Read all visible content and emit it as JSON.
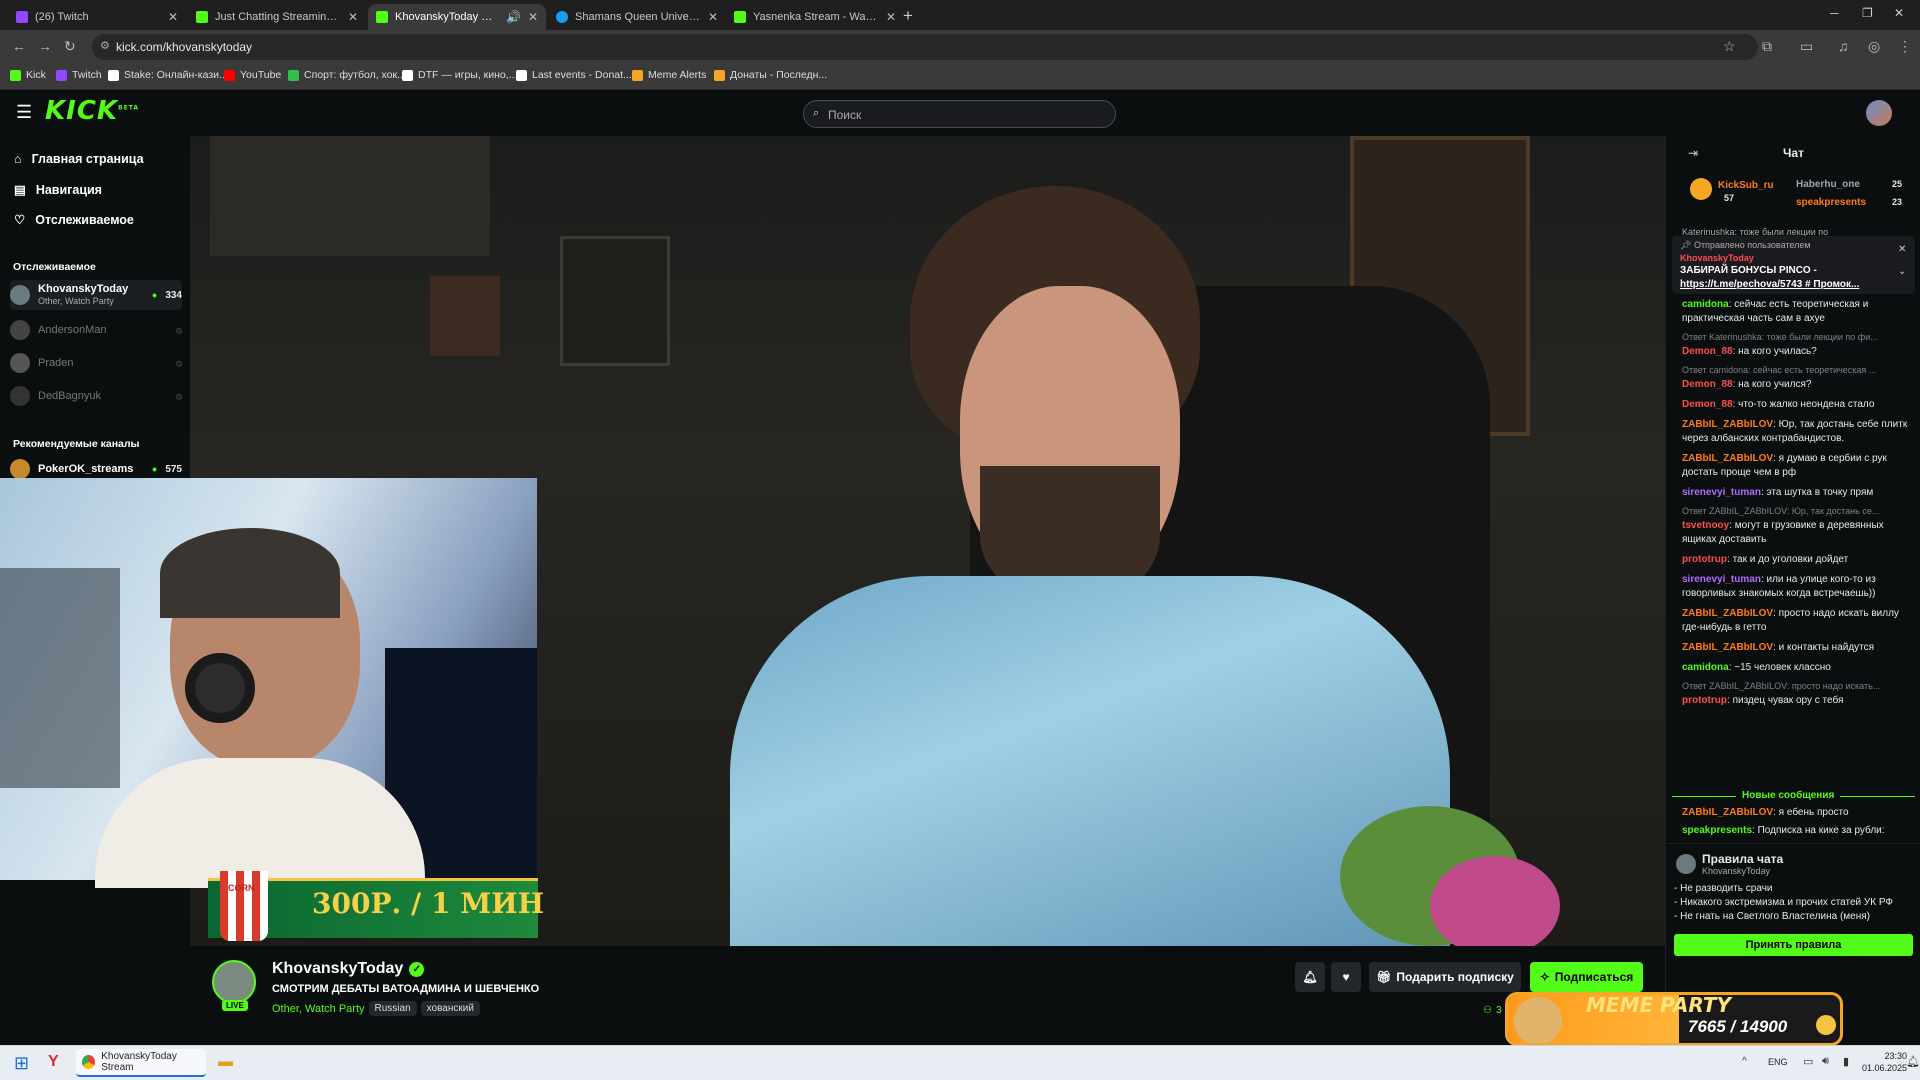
{
  "browser": {
    "tabs": [
      {
        "title": "(26) Twitch",
        "favicon_color": "#9146ff"
      },
      {
        "title": "Just Chatting Streaming - Live S",
        "favicon_color": "#53fc18"
      },
      {
        "title": "KhovanskyToday Stream - Vi",
        "favicon_color": "#53fc18",
        "active": true
      },
      {
        "title": "Shamans Queen Universe. Leve",
        "favicon_color": "#1d9bf0"
      },
      {
        "title": "Yasnenka Stream - Watch Live o",
        "favicon_color": "#53fc18"
      }
    ],
    "new_tab_label": "+",
    "url": "kick.com/khovanskytoday",
    "bookmarks": [
      {
        "label": "Kick",
        "color": "#53fc18"
      },
      {
        "label": "Twitch",
        "color": "#9146ff"
      },
      {
        "label": "Stake: Онлайн-кази...",
        "color": "#ffffff"
      },
      {
        "label": "YouTube",
        "color": "#ff0000"
      },
      {
        "label": "Спорт: футбол, хок...",
        "color": "#2fbf4f"
      },
      {
        "label": "DTF — игры, кино,...",
        "color": "#ffffff"
      },
      {
        "label": "Last events - Donat...",
        "color": "#ffffff"
      },
      {
        "label": "Meme Alerts",
        "color": "#f5a623"
      },
      {
        "label": "Донаты - Последн...",
        "color": "#f5a623"
      }
    ]
  },
  "site": {
    "logo": "KICK",
    "logo_badge": "BETA",
    "search_placeholder": "Поиск",
    "accent": "#53fc18"
  },
  "sidebar": {
    "nav": [
      {
        "label": "Главная страница",
        "icon": "home-icon"
      },
      {
        "label": "Навигация",
        "icon": "compass-icon"
      },
      {
        "label": "Отслеживаемое",
        "icon": "heart-icon"
      }
    ],
    "following_header": "Отслеживаемое",
    "following": [
      {
        "name": "KhovanskyToday",
        "category": "Other, Watch Party",
        "viewers": "334",
        "live": true
      },
      {
        "name": "AndersonMan",
        "live": false
      },
      {
        "name": "Praden",
        "live": false
      },
      {
        "name": "DedBagnyuk",
        "live": false
      }
    ],
    "recommended_header": "Рекомендуемые каналы",
    "recommended": [
      {
        "name": "PokerOK_streams",
        "viewers": "575"
      }
    ]
  },
  "overlay": {
    "promo_text": "300Р. / 1 МИН",
    "promo_cup": "CORN"
  },
  "stream": {
    "channel": "KhovanskyToday",
    "title": "СМОТРИМ ДЕБАТЫ ВАТОАДМИНА И ШЕВЧЕНКО",
    "category": "Other, Watch Party",
    "tags": [
      "Russian",
      "хованский"
    ],
    "live_badge": "LIVE",
    "gift_label": "Подарить подписку",
    "subscribe_label": "Подписаться",
    "viewers_partial": "3"
  },
  "chat": {
    "title": "Чат",
    "top_gifters": [
      {
        "name": "KickSub_ru",
        "count": "57"
      },
      {
        "name": "Haberhu_one",
        "count": "25"
      },
      {
        "name": "speakpresents",
        "count": "23"
      }
    ],
    "pinned": {
      "header": "Отправлено пользователем",
      "author": "KhovanskyToday",
      "text": "ЗАБИРАЙ БОНУСЫ PINCO -",
      "link": "https://t.me/pechova/5743 # Промок..."
    },
    "cutoff_top": "Katerinushka: тоже были лекции по",
    "messages": [
      {
        "reply": "",
        "user": "camidona",
        "color": "#53fc18",
        "text": "сейчас есть теоретическая и практическая часть сам в ахуе"
      },
      {
        "reply": "Ответ Katerinushka: тоже были лекции по фи...",
        "user": "Demon_88",
        "color": "#ff4d4d",
        "text": "на кого училась?"
      },
      {
        "reply": "Ответ camidona: сейчас есть теоретическая ...",
        "user": "Demon_88",
        "color": "#ff4d4d",
        "text": "на кого учился?"
      },
      {
        "reply": "",
        "user": "Demon_88",
        "color": "#ff4d4d",
        "text": "что-то жалко неондена стало"
      },
      {
        "reply": "",
        "user": "ZABbIL_ZABbILOV",
        "color": "#ff7a1a",
        "text": "Юр, так достань себе плитк через албанских контрабандистов."
      },
      {
        "reply": "",
        "user": "ZABbIL_ZABbILOV",
        "color": "#ff7a1a",
        "text": "я думаю в сербии с рук достать проще чем в рф"
      },
      {
        "reply": "",
        "user": "sirenevyi_tuman",
        "color": "#b06cff",
        "text": "эта шутка в точку прям"
      },
      {
        "reply": "Ответ ZABbIL_ZABbILOV: Юр, так достань се...",
        "user": "tsvetnooy",
        "color": "#ff4d4d",
        "text": "могут в грузовике в деревянных ящиках доставить"
      },
      {
        "reply": "",
        "user": "prototrup",
        "color": "#ff4d4d",
        "text": "так и до уголовки дойдет"
      },
      {
        "reply": "",
        "user": "sirenevyi_tuman",
        "color": "#b06cff",
        "text": "или на улице кого-то из говорливых знакомых когда встречаешь))"
      },
      {
        "reply": "",
        "user": "ZABbIL_ZABbILOV",
        "color": "#ff7a1a",
        "text": "просто надо искать виллу где-нибудь в гетто"
      },
      {
        "reply": "",
        "user": "ZABbIL_ZABbILOV",
        "color": "#ff7a1a",
        "text": "и контакты найдутся"
      },
      {
        "reply": "",
        "user": "camidona",
        "color": "#53fc18",
        "text": "~15 человек классно"
      },
      {
        "reply": "Ответ ZABbIL_ZABbILOV: просто надо искать...",
        "user": "prototrup",
        "color": "#ff4d4d",
        "text": "пиздец чувак ору с тебя"
      }
    ],
    "new_messages": "Новые сообщения",
    "after": [
      {
        "user": "ZABbIL_ZABbILOV",
        "color": "#ff7a1a",
        "text": "я ебень просто"
      },
      {
        "user": "speakpresents",
        "color": "#53fc18",
        "text": "Подписка на кике за рубли:"
      }
    ],
    "rules": {
      "title": "Правила чата",
      "channel": "KhovanskyToday",
      "items": [
        "- Не разводить срачи",
        "- Никакого экстремизма и прочих статей УК РФ",
        "- Не гнать на Светлого Властелина (меня)"
      ],
      "accept": "Принять правила"
    }
  },
  "widget": {
    "title": "MEME PARTY",
    "progress": "7665 / 14900",
    "fraction": 0.514
  },
  "taskbar": {
    "app": "KhovanskyToday Stream",
    "lang": "ENG",
    "time": "23:30",
    "date": "01.06.2025"
  }
}
